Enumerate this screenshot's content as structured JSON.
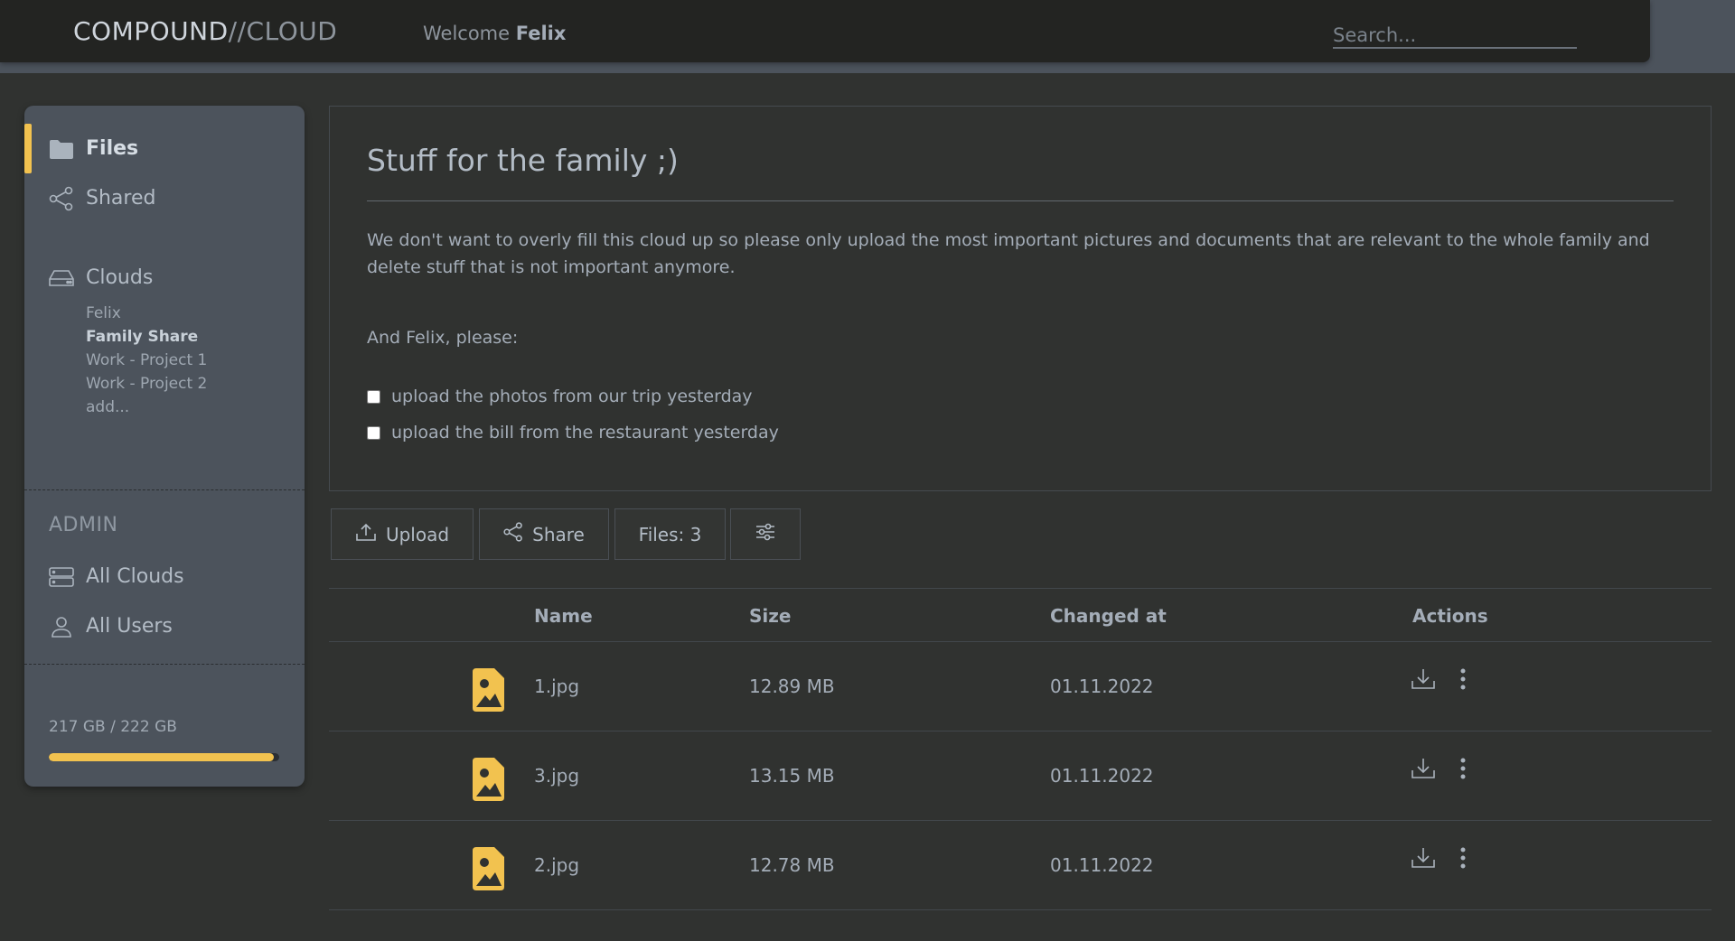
{
  "header": {
    "brand_part1": "COMPOUND",
    "brand_sep": "//",
    "brand_part2": "CLOUD",
    "welcome_prefix": "Welcome",
    "user_name": "Felix",
    "search_placeholder": "Search..."
  },
  "sidebar": {
    "files_label": "Files",
    "shared_label": "Shared",
    "clouds_label": "Clouds",
    "clouds": [
      {
        "name": "Felix",
        "selected": false
      },
      {
        "name": "Family Share",
        "selected": true
      },
      {
        "name": "Work - Project 1",
        "selected": false
      },
      {
        "name": "Work - Project 2",
        "selected": false
      },
      {
        "name": "add...",
        "selected": false
      }
    ],
    "admin_heading": "ADMIN",
    "all_clouds_label": "All Clouds",
    "all_users_label": "All Users",
    "storage_text": "217 GB / 222 GB",
    "storage_used_fraction": 0.977
  },
  "note": {
    "title": "Stuff for the family ;)",
    "paragraph": "We don't want to overly fill this cloud up so please only upload the most important pictures and documents that are relevant to the whole family and delete stuff that is not important anymore.",
    "please_line": "And Felix, please:",
    "todos": [
      {
        "text": "upload the photos from our trip yesterday",
        "checked": false
      },
      {
        "text": "upload the bill from the restaurant yesterday",
        "checked": false
      }
    ]
  },
  "toolbar": {
    "upload_label": "Upload",
    "share_label": "Share",
    "files_count_label": "Files: 3"
  },
  "table": {
    "columns": [
      "Name",
      "Size",
      "Changed at",
      "Actions"
    ],
    "rows": [
      {
        "name": "1.jpg",
        "size": "12.89 MB",
        "changed": "01.11.2022"
      },
      {
        "name": "3.jpg",
        "size": "13.15 MB",
        "changed": "01.11.2022"
      },
      {
        "name": "2.jpg",
        "size": "12.78 MB",
        "changed": "01.11.2022"
      }
    ]
  },
  "colors": {
    "accent": "#f2c24f",
    "sidebar_bg": "#4c535c",
    "page_bg": "#303230",
    "topbar_bg": "#232422"
  }
}
